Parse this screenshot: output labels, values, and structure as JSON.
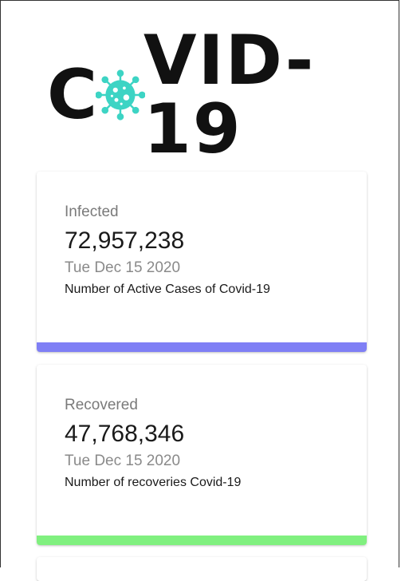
{
  "logo": {
    "before": "C",
    "after": "VID-19",
    "virus_color": "#3dd4c4"
  },
  "cards": [
    {
      "title": "Infected",
      "count": "72,957,238",
      "date": "Tue Dec 15 2020",
      "description": "Number of Active Cases of Covid-19",
      "bar_color": "#7f7ff5"
    },
    {
      "title": "Recovered",
      "count": "47,768,346",
      "date": "Tue Dec 15 2020",
      "description": "Number of recoveries Covid-19",
      "bar_color": "#80f07f"
    }
  ]
}
